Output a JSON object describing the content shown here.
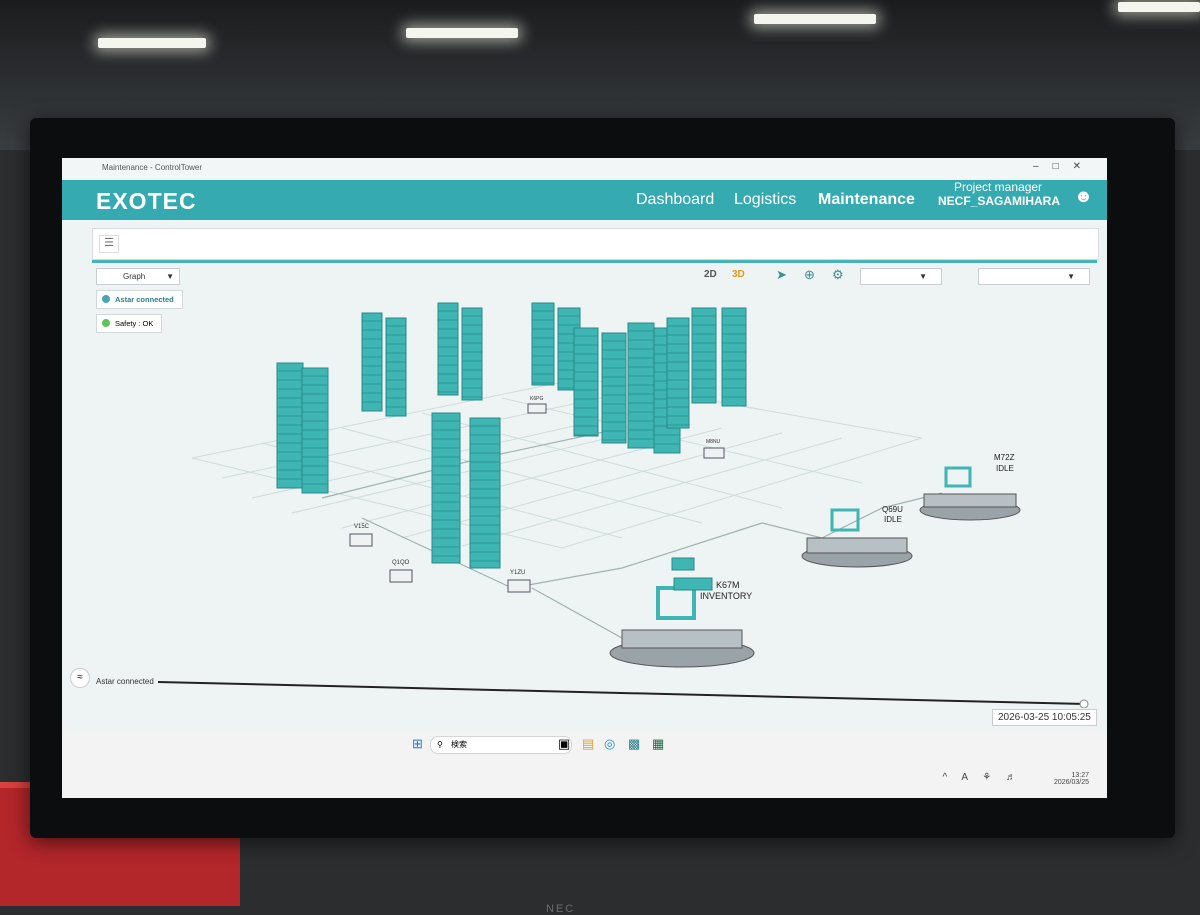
{
  "window": {
    "title": "Maintenance - ControlTower"
  },
  "app": {
    "logo": "EXOTEC",
    "nav": [
      "Dashboard",
      "Logistics",
      "Maintenance"
    ],
    "active_nav": "Maintenance",
    "role": "Project manager",
    "site": "NECF_SAGAMIHARA"
  },
  "toolbar": {
    "view_select": "Graph",
    "view_2d": "2D",
    "view_3d": "3D",
    "active_view": "3D"
  },
  "status": {
    "astar": "Astar connected",
    "safety": "Safety : OK"
  },
  "robots": [
    "V15C",
    "Q1QO",
    "Y1ZU",
    "M8NU",
    "K6PG"
  ],
  "stations": [
    {
      "id": "M72Z",
      "state": "IDLE"
    },
    {
      "id": "Q69U",
      "state": "IDLE"
    },
    {
      "id": "K67M",
      "state": "INVENTORY"
    }
  ],
  "footer": {
    "connection": "Astar connected",
    "timestamp": "2026-03-25 10:05:25"
  },
  "taskbar": {
    "search_placeholder": "検索",
    "time": "13:27",
    "date": "2026/03/25"
  },
  "monitor_brand": "NEC",
  "colors": {
    "brand": "#35aab0",
    "rack": "#3fb6b4",
    "active_view": "#e09a20",
    "safety_ok": "#5cc65a"
  }
}
